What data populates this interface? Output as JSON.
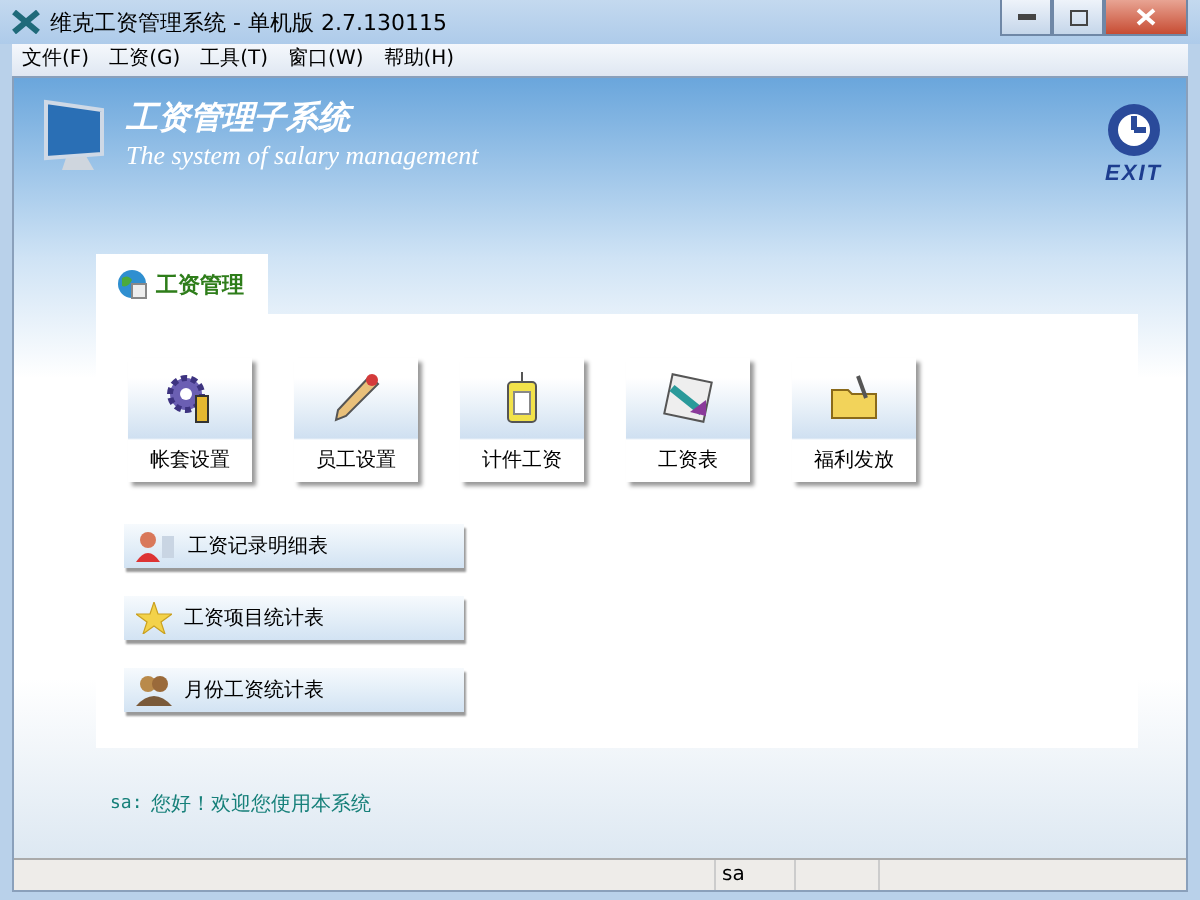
{
  "window": {
    "title": "维克工资管理系统 - 单机版 2.7.130115"
  },
  "menu": [
    "文件(F)",
    "工资(G)",
    "工具(T)",
    "窗口(W)",
    "帮助(H)"
  ],
  "header": {
    "title": "工资管理子系统",
    "subtitle": "The system of salary management",
    "exit": "EXIT"
  },
  "tabs": [
    {
      "label": "工资管理",
      "selected": true
    }
  ],
  "tiles": [
    {
      "label": "帐套设置",
      "kind": "gear"
    },
    {
      "label": "员工设置",
      "kind": "pencil"
    },
    {
      "label": "计件工资",
      "kind": "tag"
    },
    {
      "label": "工资表",
      "kind": "sheet"
    },
    {
      "label": "福利发放",
      "kind": "folder"
    }
  ],
  "reports": [
    {
      "label": "工资记录明细表",
      "kind": "person"
    },
    {
      "label": "工资项目统计表",
      "kind": "star"
    },
    {
      "label": "月份工资统计表",
      "kind": "people"
    }
  ],
  "welcome": {
    "user": "sa:",
    "message": "您好！欢迎您使用本系统"
  },
  "status_bar": [
    "sa"
  ]
}
